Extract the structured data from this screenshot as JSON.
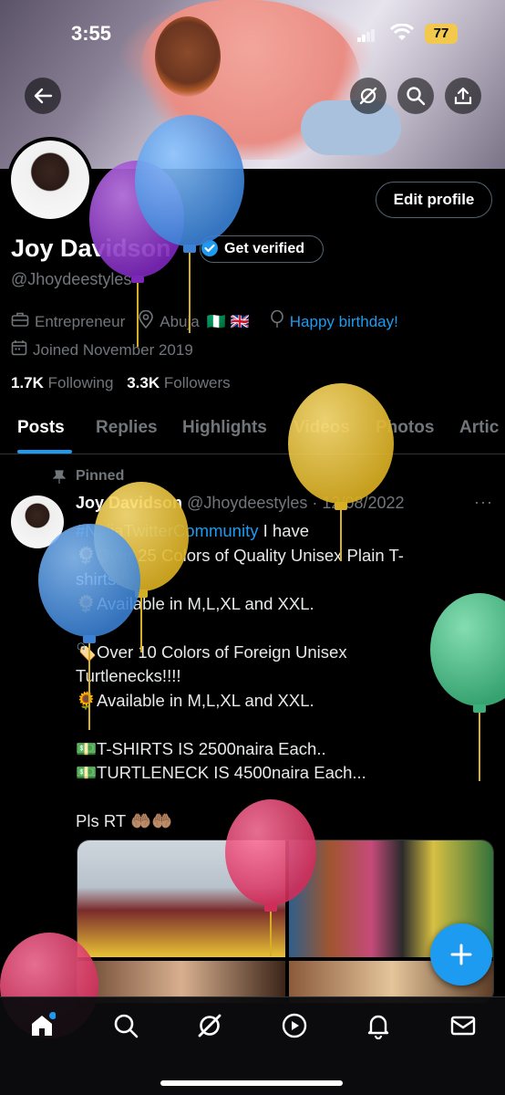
{
  "status_bar": {
    "time": "3:55",
    "battery": "77"
  },
  "header": {
    "back_icon": "arrow-left-icon",
    "grok_icon": "grok-icon",
    "search_icon": "search-icon",
    "share_icon": "share-icon"
  },
  "profile": {
    "edit_label": "Edit profile",
    "name": "Joy Davidson",
    "verified_label": "Get verified",
    "handle": "@Jhoydeestyles",
    "profession": "Entrepreneur",
    "location": "Abuja",
    "location_flags": "🇳🇬 🇬🇧",
    "birthday": "Happy birthday!",
    "joined": "Joined November 2019",
    "following_count": "1.7K",
    "following_label": "Following",
    "followers_count": "3.3K",
    "followers_label": "Followers"
  },
  "tabs": [
    "Posts",
    "Replies",
    "Highlights",
    "Videos",
    "Photos",
    "Artic"
  ],
  "post": {
    "pinned_label": "Pinned",
    "author": "Joy Davidson",
    "author_handle": "@Jhoydeestyles",
    "date": "12/08/2022",
    "hashtag": "#NaijaTwitterCommunity",
    "lines": [
      " I have",
      "🌻Over 25 Colors of Quality Unisex Plain T-",
      "shirts!!!",
      "🌻Available in M,L,XL and XXL.",
      "",
      "🏷️Over 10 Colors of Foreign Unisex",
      "Turtlenecks!!!!",
      "🌻Available in M,L,XL and XXL.",
      "",
      "💵T-SHIRTS IS 2500naira Each..",
      "💵TURTLENECK IS 4500naira Each...",
      "",
      "Pls RT 🤲🏽🤲🏽"
    ]
  },
  "fab_icon": "plus-icon",
  "bottom_nav": [
    "home-icon",
    "search-icon",
    "grok-icon",
    "play-icon",
    "bell-icon",
    "mail-icon"
  ],
  "colors": {
    "accent": "#1d9bf0",
    "background": "#000000",
    "muted": "#71767b"
  },
  "balloons": [
    "purple",
    "blue",
    "yellow",
    "yellow",
    "blue",
    "green",
    "pink",
    "pink"
  ]
}
